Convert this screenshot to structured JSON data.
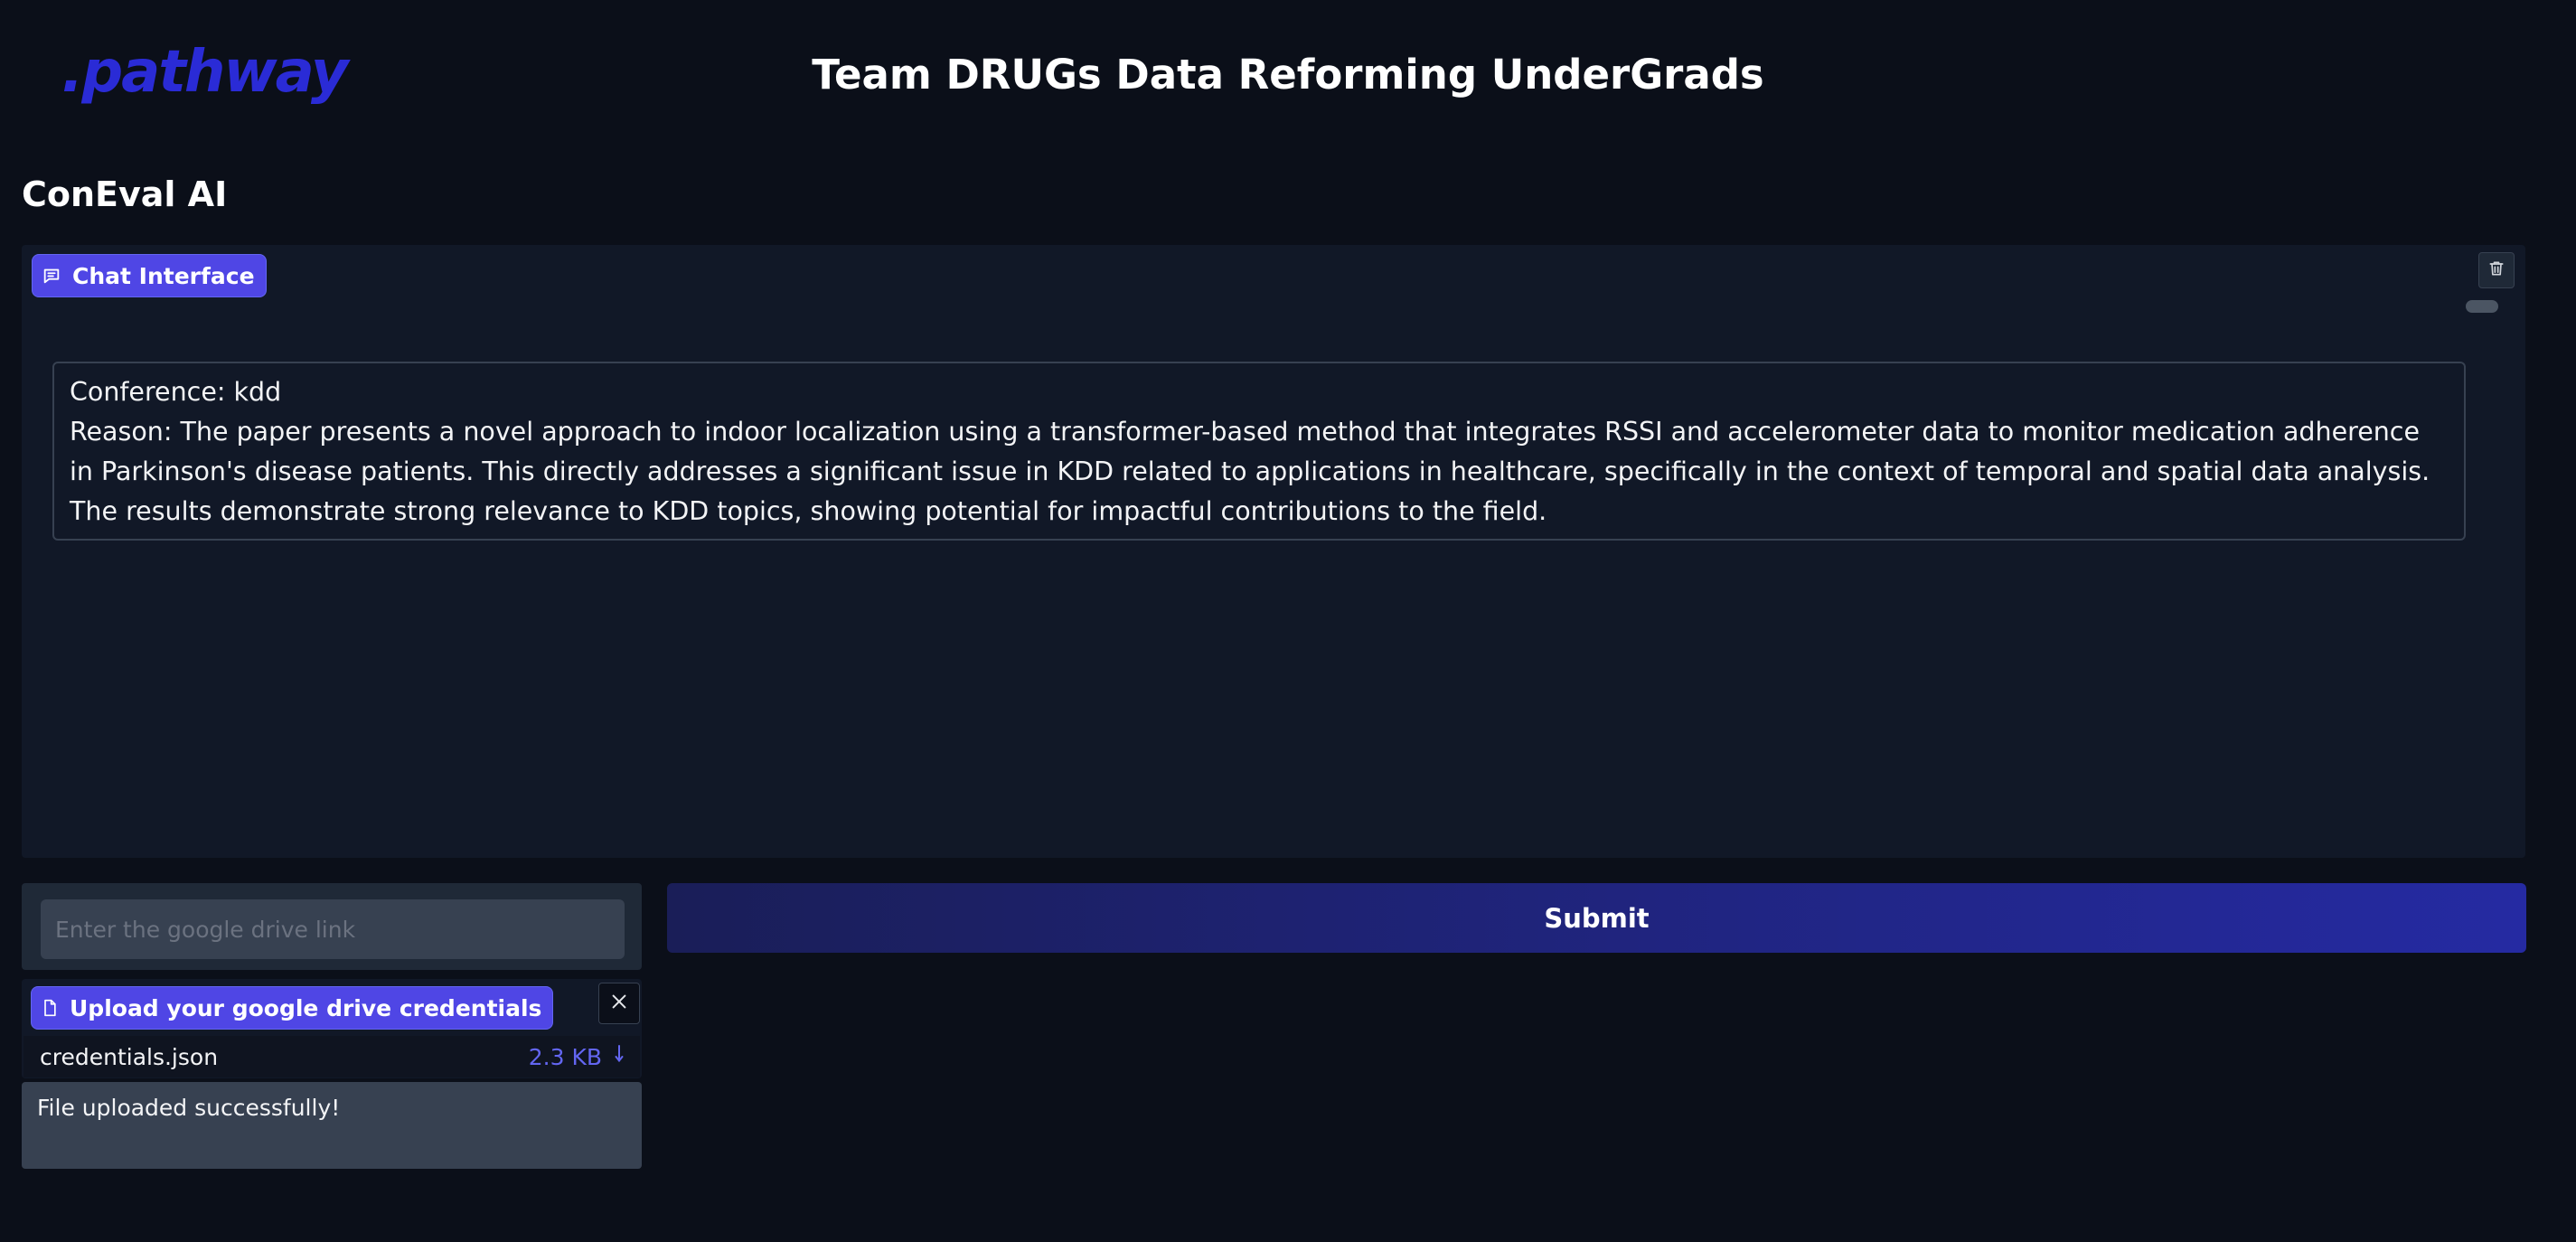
{
  "header": {
    "logo_text": ".pathway",
    "title": "Team DRUGs Data Reforming UnderGrads"
  },
  "app": {
    "title": "ConEval AI"
  },
  "chat": {
    "label": "Chat Interface",
    "label_icon": "chat-bubble-icon",
    "clear_icon": "trash-icon",
    "messages": [
      {
        "lines": [
          "Conference: kdd",
          "Reason: The paper presents a novel approach to indoor localization using a transformer-based method that integrates RSSI and accelerometer data to monitor medication adherence in Parkinson's disease patients. This directly addresses a significant issue in KDD related to applications in healthcare, specifically in the context of temporal and spatial data analysis. The results demonstrate strong relevance to KDD topics, showing potential for impactful contributions to the field."
        ]
      }
    ]
  },
  "drive_link": {
    "value": "",
    "placeholder": "Enter the google drive link"
  },
  "submit": {
    "label": "Submit"
  },
  "upload": {
    "label": "Upload your google drive credentials",
    "label_icon": "file-icon",
    "close_icon": "close-icon",
    "file": {
      "name": "credentials.json",
      "size": "2.3 KB",
      "download_icon": "download-icon"
    }
  },
  "status": {
    "message": "File uploaded successfully!"
  },
  "colors": {
    "background": "#0b0f19",
    "panel": "#111827",
    "accent": "#4f46e5",
    "logo": "#2a2bd6",
    "submit_start": "#1a1e58",
    "submit_end": "#252aa2"
  }
}
